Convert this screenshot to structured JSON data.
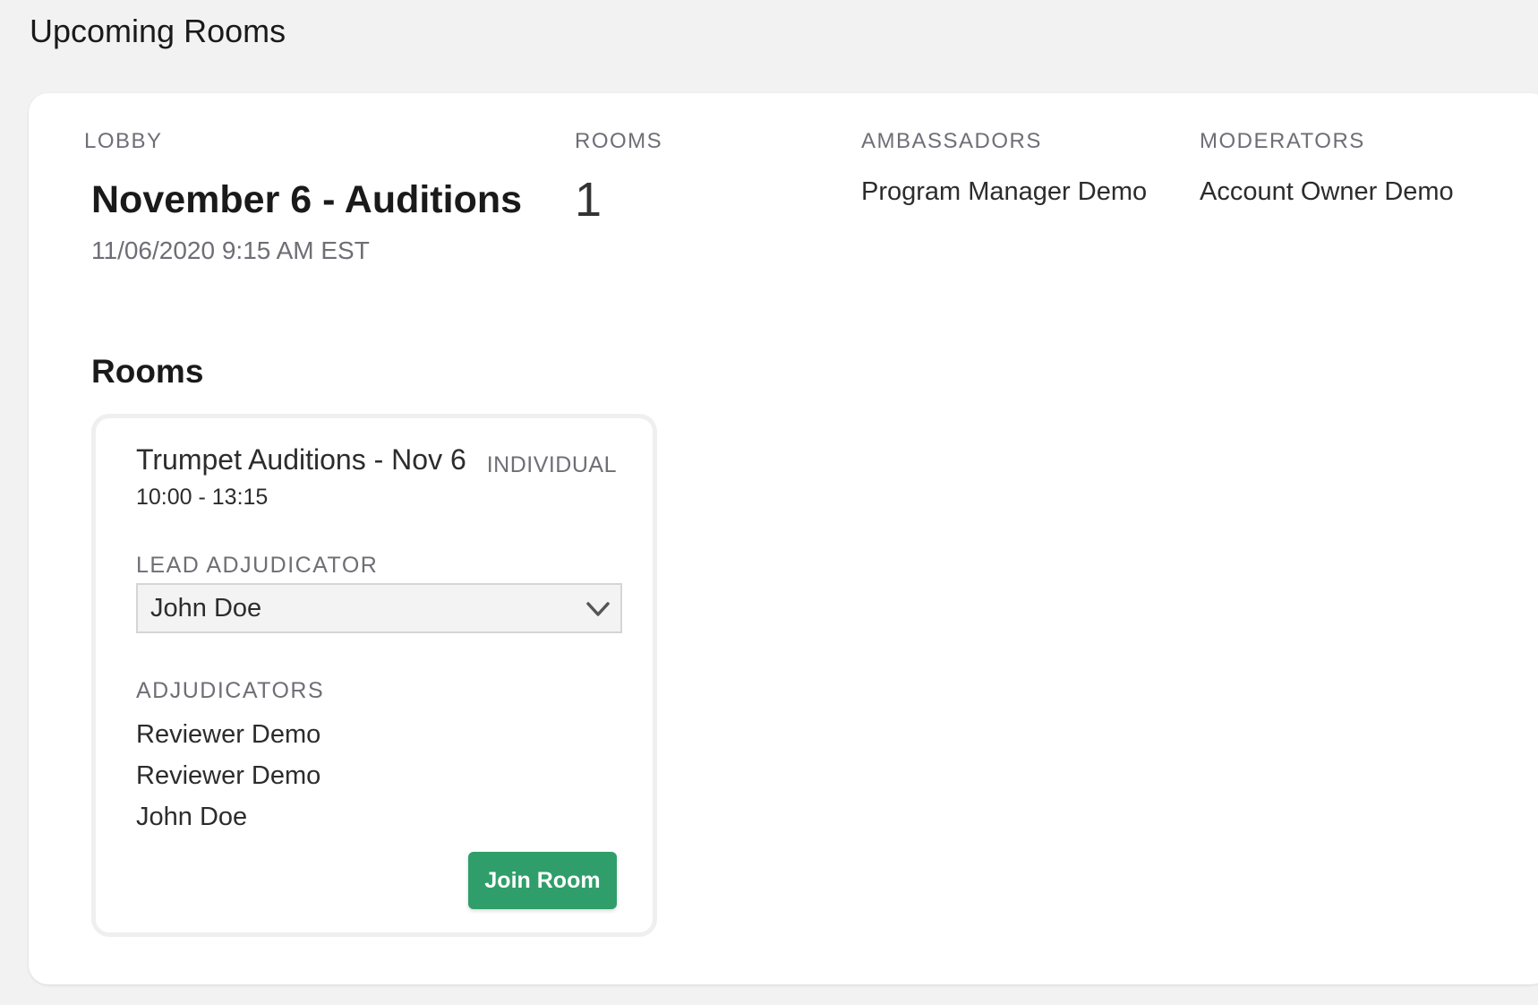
{
  "page": {
    "title": "Upcoming Rooms"
  },
  "lobby": {
    "label": "LOBBY",
    "name": "November 6 - Auditions",
    "datetime": "11/06/2020 9:15 AM EST",
    "rooms_label": "ROOMS",
    "rooms_count": "1",
    "ambassadors_label": "AMBASSADORS",
    "ambassadors": [
      "Program Manager Demo"
    ],
    "moderators_label": "MODERATORS",
    "moderators": [
      "Account Owner Demo"
    ]
  },
  "rooms_section": {
    "heading": "Rooms",
    "rooms": [
      {
        "title": "Trumpet Auditions - Nov 6",
        "type": "INDIVIDUAL",
        "time": "10:00 - 13:15",
        "lead_adjudicator_label": "LEAD ADJUDICATOR",
        "lead_adjudicator_selected": "John Doe",
        "adjudicators_label": "ADJUDICATORS",
        "adjudicators": [
          "Reviewer Demo",
          "Reviewer Demo",
          "John Doe"
        ],
        "join_label": "Join Room",
        "join_color": "#2f9e6a"
      }
    ]
  },
  "icons": {
    "dropdown": "chevron-down-icon"
  }
}
